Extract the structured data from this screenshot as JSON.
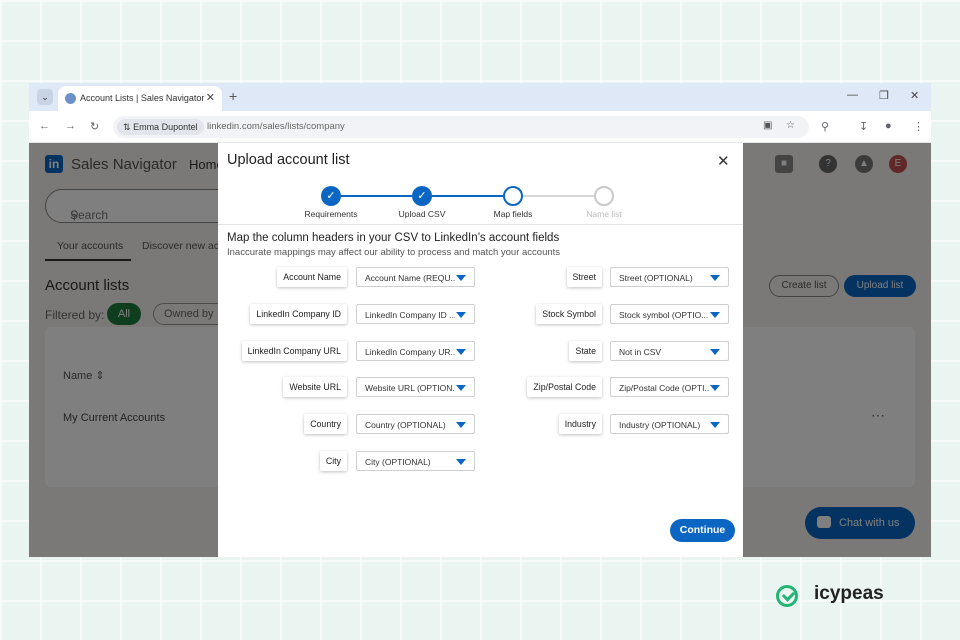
{
  "browser": {
    "tab_title": "Account Lists | Sales Navigator",
    "profile_chip": "Emma Dupontel",
    "url": "linkedin.com/sales/lists/company"
  },
  "page": {
    "app_name": "Sales Navigator",
    "nav_home": "Home",
    "search_placeholder": "Search",
    "tabs": [
      "Your accounts",
      "Discover new ac"
    ],
    "heading": "Account lists",
    "filtered_by": "Filtered by:",
    "filter_all": "All",
    "filter_owned": "Owned by",
    "column_name": "Name",
    "list_row": "My Current Accounts",
    "create_list": "Create list",
    "upload_list": "Upload list",
    "chat": "Chat with us",
    "avatar_initial": "E"
  },
  "modal": {
    "title": "Upload account list",
    "steps": [
      {
        "label": "Requirements",
        "state": "done"
      },
      {
        "label": "Upload CSV",
        "state": "done"
      },
      {
        "label": "Map fields",
        "state": "active"
      },
      {
        "label": "Name list",
        "state": "pending"
      }
    ],
    "heading": "Map the column headers in your CSV to LinkedIn’s account fields",
    "subheading": "Inaccurate mappings may affect our ability to process and match your accounts",
    "left_fields": [
      {
        "label": "Account Name",
        "value": "Account Name (REQU..."
      },
      {
        "label": "LinkedIn Company ID",
        "value": "LinkedIn Company ID ..."
      },
      {
        "label": "LinkedIn Company URL",
        "value": "LinkedIn Company UR..."
      },
      {
        "label": "Website URL",
        "value": "Website URL (OPTION..."
      },
      {
        "label": "Country",
        "value": "Country (OPTIONAL)"
      },
      {
        "label": "City",
        "value": "City (OPTIONAL)"
      }
    ],
    "right_fields": [
      {
        "label": "Street",
        "value": "Street (OPTIONAL)"
      },
      {
        "label": "Stock Symbol",
        "value": "Stock symbol (OPTIO..."
      },
      {
        "label": "State",
        "value": "Not in CSV"
      },
      {
        "label": "Zip/Postal Code",
        "value": "Zip/Postal Code (OPTI..."
      },
      {
        "label": "Industry",
        "value": "Industry (OPTIONAL)"
      }
    ],
    "continue_label": "Continue"
  },
  "brand": {
    "name": "icypeas"
  },
  "colors": {
    "accent": "#0a66c2",
    "brand_green": "#22b573"
  }
}
